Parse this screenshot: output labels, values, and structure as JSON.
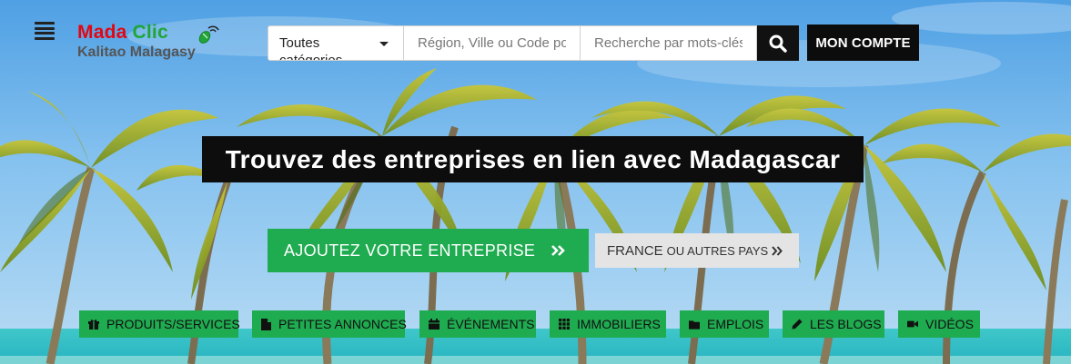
{
  "header": {
    "menu_icon": "hamburger-menu-icon",
    "logo": {
      "word1": "Mada",
      "word2": "Clic",
      "tagline": "Kalitao Malagasy",
      "icon": "mouse-icon",
      "colors": {
        "mada": "#e30613",
        "clic": "#1fa637",
        "tagline": "#555555"
      }
    },
    "search": {
      "category_value": "Toutes catégories",
      "location_placeholder": "Région, Ville ou Code postal",
      "keywords_placeholder": "Recherche par mots-clés",
      "button_icon": "search-icon"
    },
    "account_label": "MON COMPTE"
  },
  "hero": {
    "title": "Trouvez des entreprises en lien avec Madagascar",
    "add_business_label": "AJOUTEZ VOTRE ENTREPRISE",
    "country_label_main": "FRANCE",
    "country_label_rest": "OU AUTRES PAYS",
    "chevron_icon": "double-chevron-right-icon"
  },
  "categories": [
    {
      "label": "PRODUITS/SERVICES",
      "icon": "gift-icon"
    },
    {
      "label": "PETITES ANNONCES",
      "icon": "file-icon"
    },
    {
      "label": "ÉVÉNEMENTS",
      "icon": "calendar-icon"
    },
    {
      "label": "IMMOBILIERS",
      "icon": "grid-icon"
    },
    {
      "label": "EMPLOIS",
      "icon": "folder-icon"
    },
    {
      "label": "LES BLOGS",
      "icon": "pencil-icon"
    },
    {
      "label": "VIDÉOS",
      "icon": "video-camera-icon"
    }
  ],
  "colors": {
    "accent_green": "#1fab50",
    "dark": "#0d0d0d",
    "country_button_bg": "#e4e4e4"
  }
}
